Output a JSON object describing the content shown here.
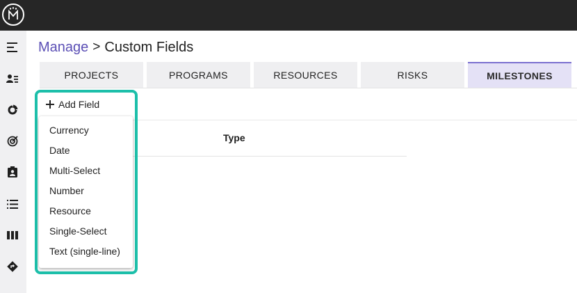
{
  "topbar": {
    "logo_icon": "monogram-logo-icon"
  },
  "sidebar": {
    "items": [
      {
        "icon": "menu-collapse-icon"
      },
      {
        "icon": "people-list-icon"
      },
      {
        "icon": "donut-chart-icon"
      },
      {
        "icon": "target-icon"
      },
      {
        "icon": "clipboard-user-icon"
      },
      {
        "icon": "bulleted-list-icon"
      },
      {
        "icon": "columns-icon"
      },
      {
        "icon": "directions-sign-icon"
      }
    ]
  },
  "breadcrumb": {
    "parent": "Manage",
    "separator": ">",
    "current": "Custom Fields"
  },
  "tabs": [
    {
      "label": "PROJECTS",
      "active": false
    },
    {
      "label": "PROGRAMS",
      "active": false
    },
    {
      "label": "RESOURCES",
      "active": false
    },
    {
      "label": "RISKS",
      "active": false
    },
    {
      "label": "MILESTONES",
      "active": true
    }
  ],
  "toolbar": {
    "add_field_label": "Add Field"
  },
  "table": {
    "columns": [
      "Type"
    ]
  },
  "add_field_menu": {
    "options": [
      "Currency",
      "Date",
      "Multi-Select",
      "Number",
      "Resource",
      "Single-Select",
      "Text (single-line)"
    ]
  },
  "colors": {
    "topbar": "#262626",
    "sidebar": "#f0f0f2",
    "breadcrumb_link": "#5b4fb5",
    "active_tab_bg": "#e4e1f6",
    "active_tab_border": "#7a6fd0",
    "highlight": "#1dbfaa"
  }
}
